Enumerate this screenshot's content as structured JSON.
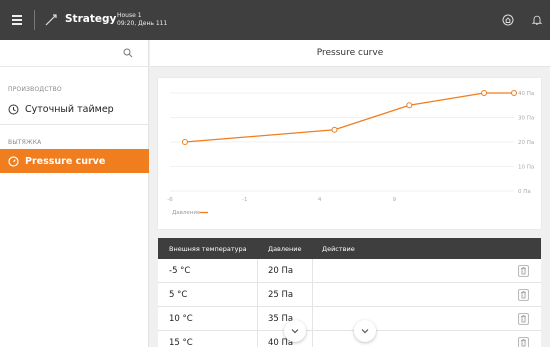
{
  "topbar": {
    "app_title": "Strategy",
    "house_name": "House 1",
    "house_time": "09:20, День 111"
  },
  "sidebar": {
    "search_icon": "search-icon",
    "sections": [
      {
        "label": "ПРОИЗВОДСТВО",
        "items": [
          {
            "label": "Суточный таймер",
            "icon": "clock-icon"
          }
        ]
      },
      {
        "label": "ВЫТЯЖКА",
        "items": [
          {
            "label": "Pressure curve",
            "icon": "gauge-icon",
            "active": true
          }
        ]
      }
    ]
  },
  "page": {
    "title": "Pressure curve"
  },
  "colors": {
    "accent": "#f07d1e",
    "topbar": "#3f3f3f",
    "table_header": "#3e3e3e"
  },
  "chart_data": {
    "type": "line",
    "series": [
      {
        "name": "Давление",
        "x": [
          -5,
          5,
          10,
          15,
          17
        ],
        "y": [
          20,
          25,
          35,
          40,
          40
        ]
      }
    ],
    "x_ticks": [
      "-6",
      "-1",
      "4",
      "9"
    ],
    "y_ticks": [
      "0 Па",
      "10 Па",
      "20 Па",
      "30 Па",
      "40 Па"
    ],
    "xlim": [
      -6,
      17
    ],
    "ylim": [
      0,
      40
    ],
    "legend": "bottom-left",
    "grid": true
  },
  "table": {
    "headers": [
      "Внешняя температура",
      "Давление",
      "Действие"
    ],
    "rows": [
      {
        "temp": "-5 °C",
        "pressure": "20 Па"
      },
      {
        "temp": "5 °C",
        "pressure": "25 Па"
      },
      {
        "temp": "10 °C",
        "pressure": "35 Па"
      },
      {
        "temp": "15 °C",
        "pressure": "40 Па"
      }
    ]
  }
}
